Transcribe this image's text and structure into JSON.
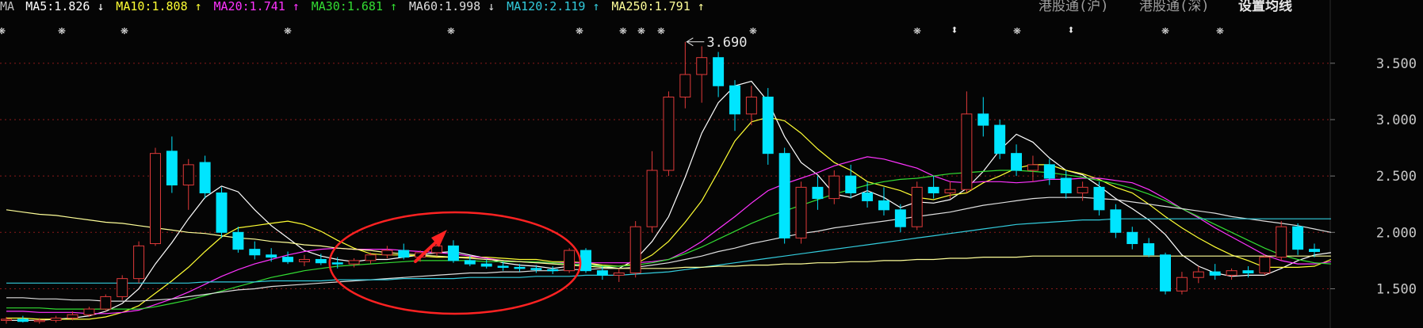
{
  "header": {
    "ma_items": [
      {
        "name": "MA",
        "value": "",
        "arrow": "",
        "color": "#bdbdbd"
      },
      {
        "name": "MA5",
        "value": "1.826",
        "arrow": "↓",
        "color": "#ffffff"
      },
      {
        "name": "MA10",
        "value": "1.808",
        "arrow": "↑",
        "color": "#ffff33"
      },
      {
        "name": "MA20",
        "value": "1.741",
        "arrow": "↑",
        "color": "#ff33ff"
      },
      {
        "name": "MA30",
        "value": "1.681",
        "arrow": "↑",
        "color": "#33dd33"
      },
      {
        "name": "MA60",
        "value": "1.998",
        "arrow": "↓",
        "color": "#dddddd"
      },
      {
        "name": "MA120",
        "value": "2.119",
        "arrow": "↑",
        "color": "#33ccdd"
      },
      {
        "name": "MA250",
        "value": "1.791",
        "arrow": "↑",
        "color": "#ffff99"
      }
    ],
    "links": [
      "港股通(沪)",
      "港股通(深)",
      "设置均线"
    ]
  },
  "chart_data": {
    "type": "candlestick",
    "ylim": [
      1.18,
      3.85
    ],
    "y_ticks": [
      "3.500",
      "3.000",
      "2.500",
      "2.000",
      "1.500"
    ],
    "peak_label": "3.690",
    "peak": {
      "x_index": 41,
      "value": 3.69
    },
    "colors": {
      "up": "#e03a3a",
      "down": "#00e5ff",
      "grid": "#8a1a1a",
      "annotation": "#ff2222"
    },
    "info_markers": [
      "star",
      "star",
      "star",
      "star",
      "star",
      "star",
      "star",
      "star",
      "star",
      "star",
      "star",
      "updown",
      "star",
      "updown",
      "star",
      "star"
    ],
    "info_marker_glyphs": {
      "star": "❋",
      "updown": "⬍"
    },
    "annotation": {
      "shape": "ellipse-with-arrow",
      "from_index": 20,
      "to_index": 34
    },
    "candles": [
      {
        "o": 1.22,
        "h": 1.25,
        "l": 1.19,
        "c": 1.23
      },
      {
        "o": 1.23,
        "h": 1.26,
        "l": 1.2,
        "c": 1.21
      },
      {
        "o": 1.21,
        "h": 1.24,
        "l": 1.19,
        "c": 1.22
      },
      {
        "o": 1.22,
        "h": 1.26,
        "l": 1.2,
        "c": 1.24
      },
      {
        "o": 1.24,
        "h": 1.3,
        "l": 1.22,
        "c": 1.27
      },
      {
        "o": 1.27,
        "h": 1.34,
        "l": 1.25,
        "c": 1.32
      },
      {
        "o": 1.32,
        "h": 1.45,
        "l": 1.3,
        "c": 1.43
      },
      {
        "o": 1.43,
        "h": 1.62,
        "l": 1.4,
        "c": 1.59
      },
      {
        "o": 1.59,
        "h": 1.92,
        "l": 1.55,
        "c": 1.88
      },
      {
        "o": 1.9,
        "h": 2.75,
        "l": 1.88,
        "c": 2.7
      },
      {
        "o": 2.72,
        "h": 2.85,
        "l": 2.35,
        "c": 2.42
      },
      {
        "o": 2.42,
        "h": 2.65,
        "l": 2.2,
        "c": 2.6
      },
      {
        "o": 2.62,
        "h": 2.68,
        "l": 2.3,
        "c": 2.35
      },
      {
        "o": 2.35,
        "h": 2.4,
        "l": 1.95,
        "c": 2.0
      },
      {
        "o": 2.0,
        "h": 2.05,
        "l": 1.82,
        "c": 1.85
      },
      {
        "o": 1.85,
        "h": 1.92,
        "l": 1.76,
        "c": 1.8
      },
      {
        "o": 1.8,
        "h": 1.86,
        "l": 1.74,
        "c": 1.78
      },
      {
        "o": 1.78,
        "h": 1.83,
        "l": 1.72,
        "c": 1.74
      },
      {
        "o": 1.74,
        "h": 1.8,
        "l": 1.7,
        "c": 1.76
      },
      {
        "o": 1.76,
        "h": 1.81,
        "l": 1.71,
        "c": 1.73
      },
      {
        "o": 1.73,
        "h": 1.78,
        "l": 1.68,
        "c": 1.72
      },
      {
        "o": 1.72,
        "h": 1.77,
        "l": 1.69,
        "c": 1.75
      },
      {
        "o": 1.75,
        "h": 1.82,
        "l": 1.72,
        "c": 1.8
      },
      {
        "o": 1.8,
        "h": 1.88,
        "l": 1.77,
        "c": 1.84
      },
      {
        "o": 1.84,
        "h": 1.9,
        "l": 1.76,
        "c": 1.78
      },
      {
        "o": 1.78,
        "h": 1.84,
        "l": 1.74,
        "c": 1.82
      },
      {
        "o": 1.82,
        "h": 1.9,
        "l": 1.79,
        "c": 1.88
      },
      {
        "o": 1.88,
        "h": 1.93,
        "l": 1.73,
        "c": 1.75
      },
      {
        "o": 1.75,
        "h": 1.79,
        "l": 1.7,
        "c": 1.72
      },
      {
        "o": 1.72,
        "h": 1.76,
        "l": 1.68,
        "c": 1.7
      },
      {
        "o": 1.7,
        "h": 1.74,
        "l": 1.66,
        "c": 1.69
      },
      {
        "o": 1.69,
        "h": 1.72,
        "l": 1.65,
        "c": 1.68
      },
      {
        "o": 1.68,
        "h": 1.71,
        "l": 1.64,
        "c": 1.67
      },
      {
        "o": 1.67,
        "h": 1.7,
        "l": 1.63,
        "c": 1.66
      },
      {
        "o": 1.66,
        "h": 1.86,
        "l": 1.64,
        "c": 1.84
      },
      {
        "o": 1.84,
        "h": 1.86,
        "l": 1.64,
        "c": 1.66
      },
      {
        "o": 1.66,
        "h": 1.7,
        "l": 1.58,
        "c": 1.62
      },
      {
        "o": 1.62,
        "h": 1.68,
        "l": 1.56,
        "c": 1.64
      },
      {
        "o": 1.64,
        "h": 2.1,
        "l": 1.6,
        "c": 2.05
      },
      {
        "o": 2.05,
        "h": 2.72,
        "l": 2.0,
        "c": 2.55
      },
      {
        "o": 2.55,
        "h": 3.25,
        "l": 2.5,
        "c": 3.2
      },
      {
        "o": 3.2,
        "h": 3.69,
        "l": 3.1,
        "c": 3.4
      },
      {
        "o": 3.4,
        "h": 3.65,
        "l": 3.15,
        "c": 3.55
      },
      {
        "o": 3.55,
        "h": 3.6,
        "l": 3.2,
        "c": 3.3
      },
      {
        "o": 3.3,
        "h": 3.35,
        "l": 2.9,
        "c": 3.05
      },
      {
        "o": 3.05,
        "h": 3.3,
        "l": 2.95,
        "c": 3.2
      },
      {
        "o": 3.2,
        "h": 3.28,
        "l": 2.6,
        "c": 2.7
      },
      {
        "o": 2.7,
        "h": 2.75,
        "l": 1.9,
        "c": 1.95
      },
      {
        "o": 1.95,
        "h": 2.45,
        "l": 1.9,
        "c": 2.4
      },
      {
        "o": 2.4,
        "h": 2.5,
        "l": 2.2,
        "c": 2.3
      },
      {
        "o": 2.3,
        "h": 2.55,
        "l": 2.25,
        "c": 2.5
      },
      {
        "o": 2.5,
        "h": 2.6,
        "l": 2.3,
        "c": 2.35
      },
      {
        "o": 2.35,
        "h": 2.45,
        "l": 2.22,
        "c": 2.28
      },
      {
        "o": 2.28,
        "h": 2.4,
        "l": 2.15,
        "c": 2.2
      },
      {
        "o": 2.2,
        "h": 2.25,
        "l": 2.0,
        "c": 2.05
      },
      {
        "o": 2.05,
        "h": 2.45,
        "l": 2.02,
        "c": 2.4
      },
      {
        "o": 2.4,
        "h": 2.5,
        "l": 2.3,
        "c": 2.35
      },
      {
        "o": 2.35,
        "h": 2.45,
        "l": 2.3,
        "c": 2.38
      },
      {
        "o": 2.38,
        "h": 3.25,
        "l": 2.35,
        "c": 3.05
      },
      {
        "o": 3.05,
        "h": 3.2,
        "l": 2.85,
        "c": 2.95
      },
      {
        "o": 2.95,
        "h": 3.0,
        "l": 2.65,
        "c": 2.7
      },
      {
        "o": 2.7,
        "h": 2.78,
        "l": 2.5,
        "c": 2.55
      },
      {
        "o": 2.55,
        "h": 2.68,
        "l": 2.45,
        "c": 2.6
      },
      {
        "o": 2.6,
        "h": 2.65,
        "l": 2.42,
        "c": 2.48
      },
      {
        "o": 2.48,
        "h": 2.55,
        "l": 2.3,
        "c": 2.35
      },
      {
        "o": 2.35,
        "h": 2.45,
        "l": 2.28,
        "c": 2.4
      },
      {
        "o": 2.4,
        "h": 2.45,
        "l": 2.15,
        "c": 2.2
      },
      {
        "o": 2.2,
        "h": 2.25,
        "l": 1.95,
        "c": 2.0
      },
      {
        "o": 2.0,
        "h": 2.05,
        "l": 1.85,
        "c": 1.9
      },
      {
        "o": 1.9,
        "h": 1.95,
        "l": 1.78,
        "c": 1.8
      },
      {
        "o": 1.8,
        "h": 1.82,
        "l": 1.45,
        "c": 1.48
      },
      {
        "o": 1.48,
        "h": 1.65,
        "l": 1.45,
        "c": 1.6
      },
      {
        "o": 1.6,
        "h": 1.7,
        "l": 1.55,
        "c": 1.65
      },
      {
        "o": 1.65,
        "h": 1.72,
        "l": 1.58,
        "c": 1.62
      },
      {
        "o": 1.62,
        "h": 1.68,
        "l": 1.58,
        "c": 1.66
      },
      {
        "o": 1.66,
        "h": 1.7,
        "l": 1.6,
        "c": 1.64
      },
      {
        "o": 1.64,
        "h": 1.8,
        "l": 1.62,
        "c": 1.78
      },
      {
        "o": 1.78,
        "h": 2.1,
        "l": 1.75,
        "c": 2.05
      },
      {
        "o": 2.05,
        "h": 2.08,
        "l": 1.8,
        "c": 1.85
      },
      {
        "o": 1.85,
        "h": 1.9,
        "l": 1.78,
        "c": 1.83
      }
    ],
    "ma_lines": [
      {
        "name": "MA5",
        "color": "#ffffff",
        "values": [
          1.22,
          1.22,
          1.22,
          1.23,
          1.24,
          1.26,
          1.3,
          1.37,
          1.5,
          1.72,
          1.91,
          2.12,
          2.31,
          2.41,
          2.36,
          2.2,
          2.06,
          1.95,
          1.84,
          1.79,
          1.76,
          1.74,
          1.76,
          1.76,
          1.78,
          1.8,
          1.82,
          1.83,
          1.8,
          1.77,
          1.73,
          1.71,
          1.7,
          1.68,
          1.7,
          1.73,
          1.7,
          1.68,
          1.76,
          1.92,
          2.14,
          2.49,
          2.88,
          3.15,
          3.3,
          3.34,
          3.16,
          2.85,
          2.62,
          2.51,
          2.34,
          2.31,
          2.37,
          2.31,
          2.22,
          2.27,
          2.26,
          2.29,
          2.39,
          2.54,
          2.73,
          2.87,
          2.8,
          2.66,
          2.55,
          2.51,
          2.41,
          2.3,
          2.21,
          2.11,
          1.98,
          1.8,
          1.7,
          1.64,
          1.61,
          1.62,
          1.62,
          1.68,
          1.75,
          1.8,
          1.82
        ]
      },
      {
        "name": "MA10",
        "color": "#ffff33",
        "values": [
          1.24,
          1.24,
          1.23,
          1.23,
          1.23,
          1.23,
          1.25,
          1.29,
          1.35,
          1.46,
          1.57,
          1.69,
          1.83,
          1.96,
          2.04,
          2.06,
          2.08,
          2.1,
          2.07,
          2.01,
          1.93,
          1.86,
          1.81,
          1.8,
          1.8,
          1.79,
          1.78,
          1.78,
          1.78,
          1.78,
          1.77,
          1.76,
          1.76,
          1.74,
          1.74,
          1.73,
          1.71,
          1.7,
          1.72,
          1.8,
          1.92,
          2.09,
          2.28,
          2.54,
          2.81,
          2.98,
          3.02,
          2.99,
          2.88,
          2.74,
          2.62,
          2.55,
          2.45,
          2.41,
          2.37,
          2.31,
          2.29,
          2.33,
          2.35,
          2.44,
          2.5,
          2.57,
          2.6,
          2.6,
          2.55,
          2.52,
          2.47,
          2.4,
          2.35,
          2.25,
          2.14,
          2.04,
          1.95,
          1.87,
          1.8,
          1.75,
          1.69,
          1.69,
          1.69,
          1.7,
          1.76
        ]
      },
      {
        "name": "MA20",
        "color": "#ff33ff",
        "values": [
          1.3,
          1.3,
          1.29,
          1.29,
          1.29,
          1.28,
          1.28,
          1.29,
          1.31,
          1.36,
          1.41,
          1.47,
          1.54,
          1.61,
          1.67,
          1.72,
          1.76,
          1.8,
          1.83,
          1.85,
          1.86,
          1.85,
          1.85,
          1.85,
          1.84,
          1.83,
          1.82,
          1.81,
          1.79,
          1.77,
          1.75,
          1.74,
          1.73,
          1.73,
          1.73,
          1.73,
          1.73,
          1.73,
          1.73,
          1.74,
          1.76,
          1.83,
          1.92,
          2.03,
          2.14,
          2.26,
          2.37,
          2.43,
          2.48,
          2.53,
          2.59,
          2.63,
          2.67,
          2.65,
          2.61,
          2.57,
          2.5,
          2.45,
          2.44,
          2.45,
          2.45,
          2.44,
          2.45,
          2.47,
          2.47,
          2.48,
          2.48,
          2.46,
          2.44,
          2.38,
          2.3,
          2.21,
          2.13,
          2.04,
          1.96,
          1.88,
          1.8,
          1.75,
          1.72,
          1.72,
          1.74
        ]
      },
      {
        "name": "MA30",
        "color": "#33dd33",
        "values": [
          1.33,
          1.33,
          1.33,
          1.32,
          1.32,
          1.32,
          1.32,
          1.32,
          1.32,
          1.34,
          1.37,
          1.4,
          1.44,
          1.48,
          1.52,
          1.56,
          1.6,
          1.63,
          1.66,
          1.68,
          1.7,
          1.71,
          1.72,
          1.73,
          1.74,
          1.75,
          1.75,
          1.75,
          1.75,
          1.74,
          1.74,
          1.74,
          1.74,
          1.73,
          1.72,
          1.71,
          1.7,
          1.7,
          1.71,
          1.73,
          1.76,
          1.81,
          1.87,
          1.94,
          2.01,
          2.08,
          2.14,
          2.19,
          2.24,
          2.29,
          2.34,
          2.38,
          2.42,
          2.45,
          2.47,
          2.48,
          2.5,
          2.52,
          2.53,
          2.54,
          2.55,
          2.55,
          2.54,
          2.53,
          2.51,
          2.49,
          2.46,
          2.43,
          2.39,
          2.34,
          2.28,
          2.21,
          2.14,
          2.07,
          2.0,
          1.93,
          1.86,
          1.8,
          1.76,
          1.73,
          1.72
        ]
      },
      {
        "name": "MA60",
        "color": "#dddddd",
        "values": [
          1.42,
          1.42,
          1.41,
          1.41,
          1.4,
          1.4,
          1.39,
          1.39,
          1.39,
          1.4,
          1.41,
          1.43,
          1.45,
          1.47,
          1.49,
          1.5,
          1.52,
          1.53,
          1.54,
          1.55,
          1.56,
          1.57,
          1.58,
          1.59,
          1.6,
          1.61,
          1.62,
          1.63,
          1.64,
          1.64,
          1.65,
          1.65,
          1.66,
          1.66,
          1.67,
          1.67,
          1.68,
          1.68,
          1.69,
          1.71,
          1.73,
          1.76,
          1.79,
          1.83,
          1.86,
          1.9,
          1.93,
          1.96,
          1.99,
          2.01,
          2.04,
          2.06,
          2.08,
          2.1,
          2.12,
          2.14,
          2.16,
          2.18,
          2.21,
          2.24,
          2.26,
          2.28,
          2.3,
          2.31,
          2.31,
          2.31,
          2.3,
          2.29,
          2.27,
          2.25,
          2.23,
          2.21,
          2.19,
          2.17,
          2.14,
          2.12,
          2.1,
          2.08,
          2.06,
          2.03,
          2.0
        ]
      },
      {
        "name": "MA120",
        "color": "#33ccdd",
        "values": [
          1.55,
          1.55,
          1.55,
          1.55,
          1.55,
          1.55,
          1.55,
          1.55,
          1.55,
          1.55,
          1.55,
          1.55,
          1.56,
          1.56,
          1.56,
          1.56,
          1.57,
          1.57,
          1.57,
          1.57,
          1.58,
          1.58,
          1.58,
          1.58,
          1.59,
          1.59,
          1.59,
          1.59,
          1.6,
          1.6,
          1.6,
          1.6,
          1.61,
          1.61,
          1.61,
          1.62,
          1.62,
          1.62,
          1.63,
          1.64,
          1.65,
          1.67,
          1.69,
          1.71,
          1.73,
          1.75,
          1.77,
          1.79,
          1.81,
          1.83,
          1.85,
          1.87,
          1.89,
          1.91,
          1.93,
          1.95,
          1.97,
          1.99,
          2.01,
          2.03,
          2.05,
          2.07,
          2.08,
          2.09,
          2.1,
          2.11,
          2.11,
          2.12,
          2.12,
          2.12,
          2.12,
          2.12,
          2.12,
          2.12,
          2.12,
          2.12,
          2.12,
          2.12,
          2.12,
          2.12,
          2.12
        ]
      },
      {
        "name": "MA250",
        "color": "#ffff99",
        "values": [
          2.2,
          2.18,
          2.16,
          2.15,
          2.13,
          2.11,
          2.09,
          2.08,
          2.06,
          2.04,
          2.02,
          2.0,
          1.99,
          1.97,
          1.95,
          1.94,
          1.92,
          1.91,
          1.89,
          1.88,
          1.86,
          1.85,
          1.84,
          1.82,
          1.81,
          1.8,
          1.79,
          1.78,
          1.77,
          1.76,
          1.75,
          1.74,
          1.73,
          1.72,
          1.71,
          1.7,
          1.69,
          1.68,
          1.68,
          1.68,
          1.68,
          1.69,
          1.69,
          1.7,
          1.7,
          1.71,
          1.71,
          1.72,
          1.72,
          1.73,
          1.73,
          1.74,
          1.74,
          1.75,
          1.75,
          1.76,
          1.76,
          1.77,
          1.77,
          1.78,
          1.78,
          1.78,
          1.79,
          1.79,
          1.79,
          1.79,
          1.79,
          1.79,
          1.79,
          1.79,
          1.79,
          1.79,
          1.79,
          1.79,
          1.79,
          1.79,
          1.79,
          1.79,
          1.79,
          1.79,
          1.79
        ]
      }
    ]
  }
}
